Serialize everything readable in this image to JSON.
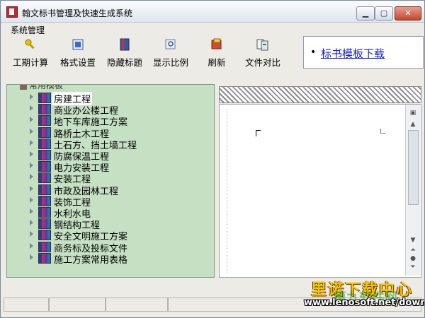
{
  "window": {
    "title": "翰文标书管理及快速生成系统"
  },
  "menu": {
    "items": [
      "系统管理"
    ]
  },
  "toolbar": {
    "buttons": [
      {
        "label": "工期计算",
        "icon": "key-icon"
      },
      {
        "label": "格式设置",
        "icon": "format-icon"
      },
      {
        "label": "隐藏标题",
        "icon": "book-icon"
      },
      {
        "label": "显示比例",
        "icon": "zoom-icon"
      },
      {
        "label": "刷新",
        "icon": "refresh-icon"
      },
      {
        "label": "文件对比",
        "icon": "compare-icon"
      }
    ]
  },
  "link_panel": {
    "bullet": "•",
    "link": "标书模板下载"
  },
  "tree": {
    "root_label": "常用模板",
    "items": [
      "房建工程",
      "商业办公楼工程",
      "地下车库施工方案",
      "路桥土木工程",
      "土石方、挡土墙工程",
      "防腐保温工程",
      "电力安装工程",
      "安装工程",
      "市政及园林工程",
      "装饰工程",
      "水利水电",
      "钢结构工程",
      "安全文明施工方案",
      "商务标及投标文件",
      "施工方案常用表格"
    ],
    "selected": "房建工程"
  },
  "watermark": {
    "line1": "里诺下载中心",
    "line2": "第九软件网",
    "url": "www.lenosoft.net/down/"
  },
  "colors": {
    "tree_bg": "#c6e0c3",
    "link": "#1a22d0",
    "close_button": "#c4452b"
  }
}
